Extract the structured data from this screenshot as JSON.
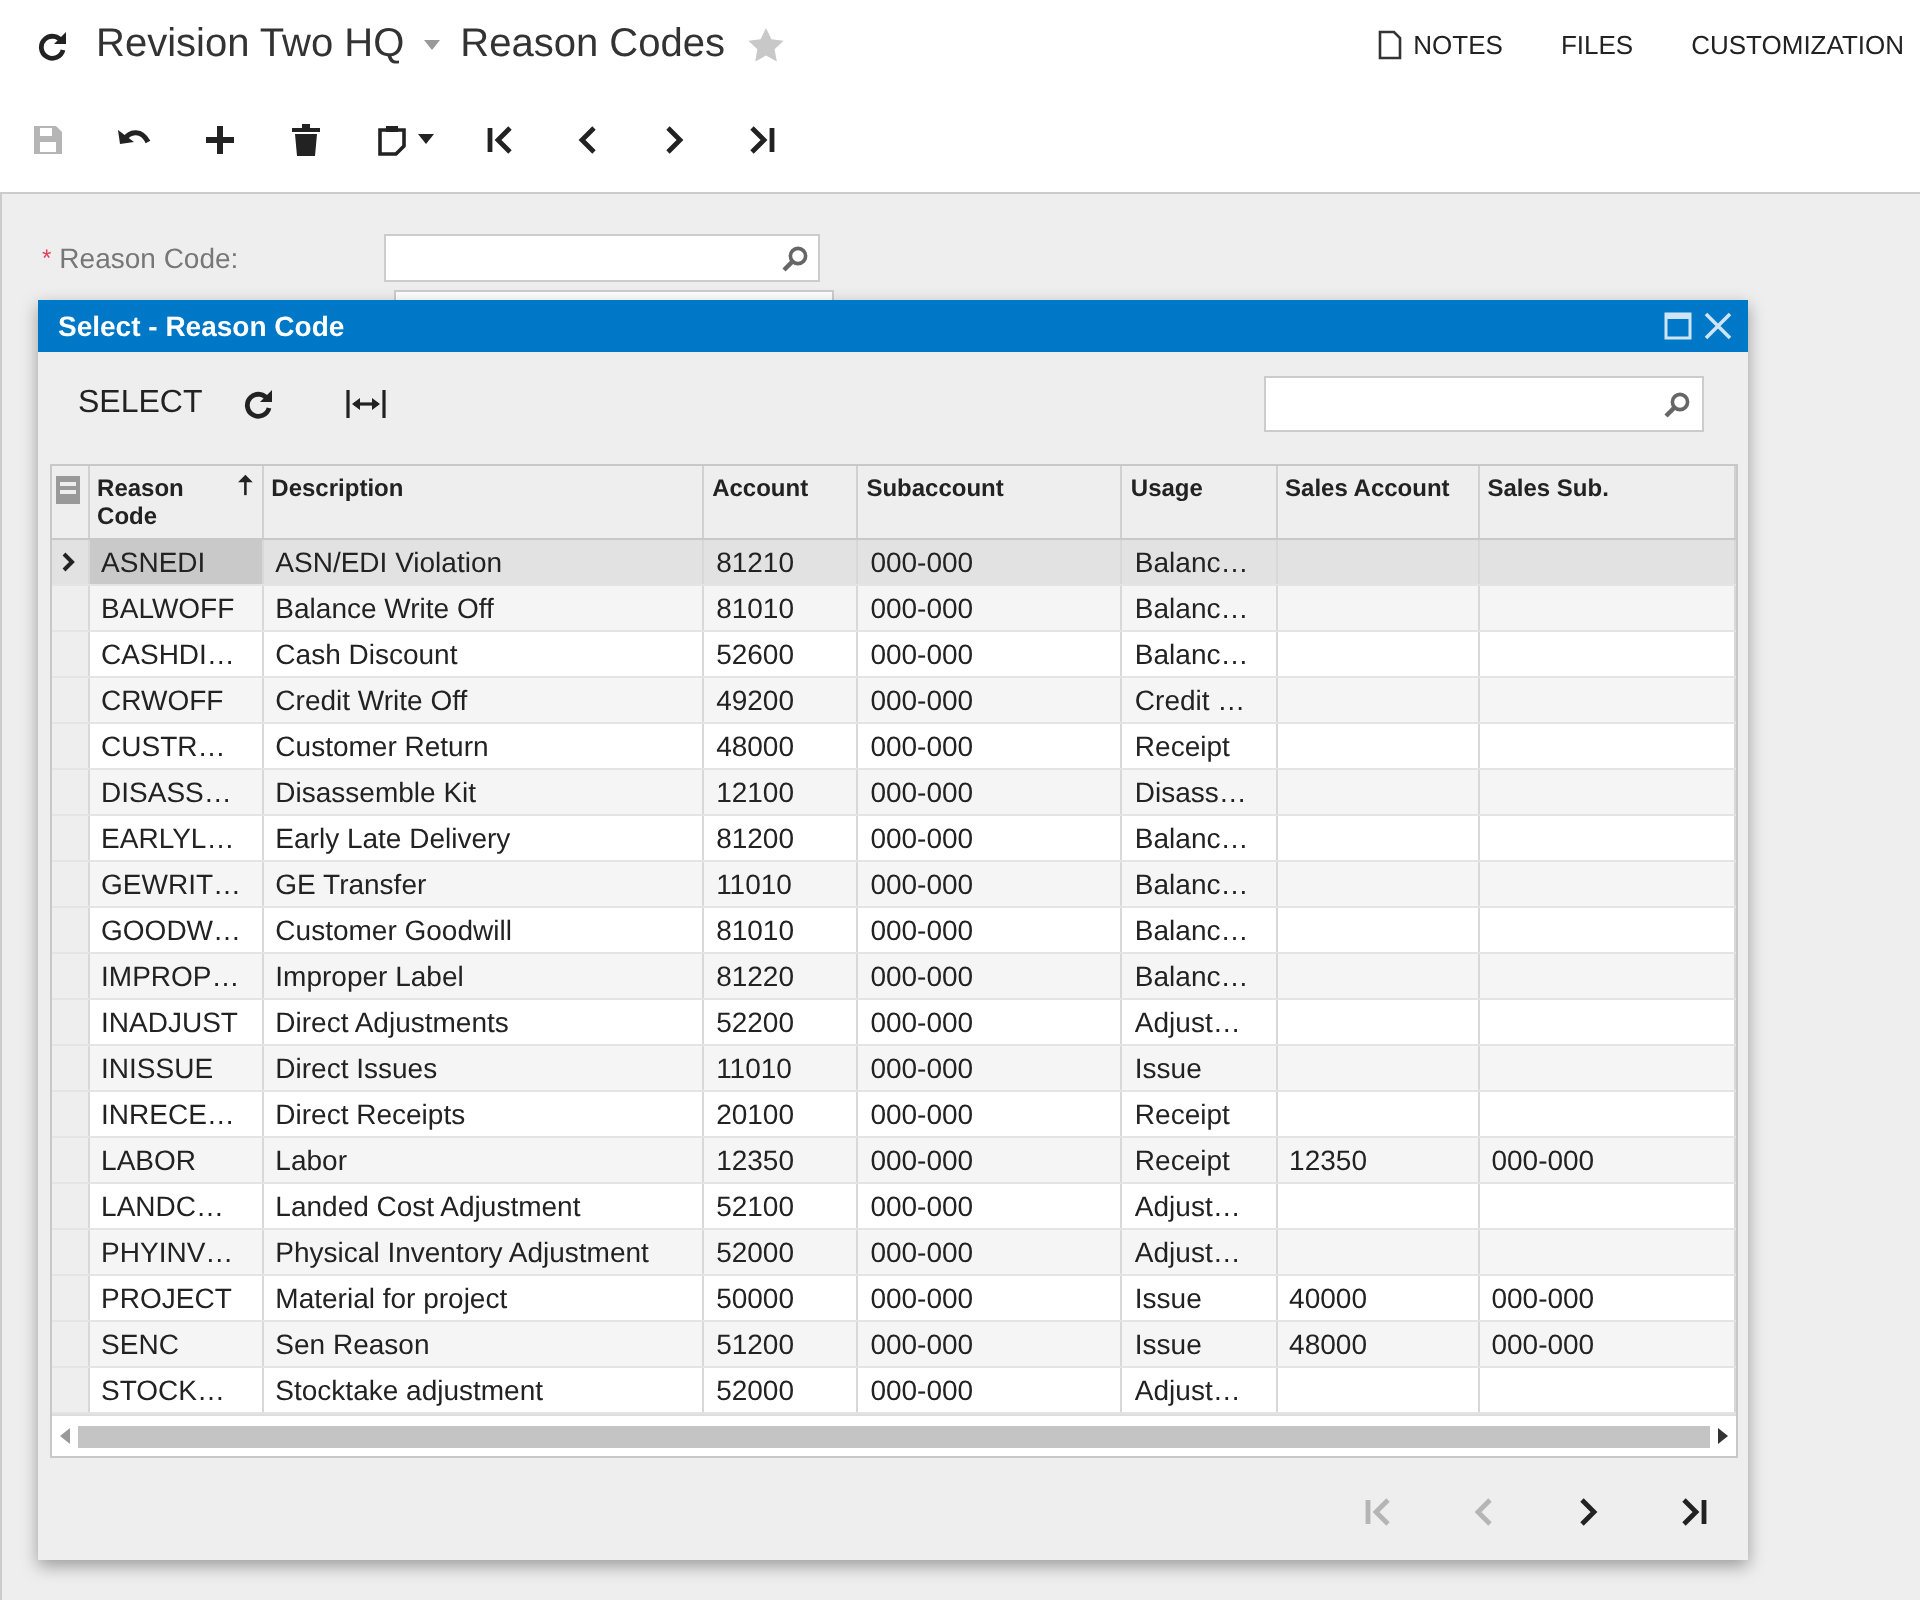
{
  "header": {
    "company": "Revision Two HQ",
    "title": "Reason Codes",
    "favorite": false,
    "links": [
      "NOTES",
      "FILES",
      "CUSTOMIZATION"
    ]
  },
  "toolbar": [
    {
      "kind": "save",
      "disabled": true
    },
    {
      "kind": "undo",
      "disabled": false
    },
    {
      "kind": "add",
      "disabled": false
    },
    {
      "kind": "delete",
      "disabled": false
    },
    {
      "kind": "clipboard",
      "disabled": false
    },
    {
      "kind": "first",
      "disabled": false
    },
    {
      "kind": "prev",
      "disabled": false
    },
    {
      "kind": "next",
      "disabled": false
    },
    {
      "kind": "last",
      "disabled": false
    }
  ],
  "form": {
    "label": "Reason Code:",
    "required_mark": "*"
  },
  "dialog": {
    "title": "Select - Reason Code",
    "select_button": "SELECT",
    "columns": [
      {
        "label": "Reason Code",
        "sorted": true
      },
      {
        "label": "Description",
        "sorted": false
      },
      {
        "label": "Account",
        "sorted": false
      },
      {
        "label": "Subaccount",
        "sorted": false
      },
      {
        "label": "Usage",
        "sorted": false
      },
      {
        "label": "Sales Account",
        "sorted": false
      },
      {
        "label": "Sales Sub.",
        "sorted": false
      }
    ],
    "rows": [
      {
        "selected": true,
        "cells": [
          "ASNEDI",
          "ASN/EDI Violation",
          "81210",
          "000-000",
          "Balanc…",
          "",
          ""
        ]
      },
      {
        "selected": false,
        "cells": [
          "BALWOFF",
          "Balance Write Off",
          "81010",
          "000-000",
          "Balanc…",
          "",
          ""
        ]
      },
      {
        "selected": false,
        "cells": [
          "CASHDI…",
          "Cash Discount",
          "52600",
          "000-000",
          "Balanc…",
          "",
          ""
        ]
      },
      {
        "selected": false,
        "cells": [
          "CRWOFF",
          "Credit Write Off",
          "49200",
          "000-000",
          "Credit …",
          "",
          ""
        ]
      },
      {
        "selected": false,
        "cells": [
          "CUSTR…",
          "Customer Return",
          "48000",
          "000-000",
          "Receipt",
          "",
          ""
        ]
      },
      {
        "selected": false,
        "cells": [
          "DISASS…",
          "Disassemble Kit",
          "12100",
          "000-000",
          "Disass…",
          "",
          ""
        ]
      },
      {
        "selected": false,
        "cells": [
          "EARLYL…",
          "Early Late Delivery",
          "81200",
          "000-000",
          "Balanc…",
          "",
          ""
        ]
      },
      {
        "selected": false,
        "cells": [
          "GEWRIT…",
          "GE Transfer",
          "11010",
          "000-000",
          "Balanc…",
          "",
          ""
        ]
      },
      {
        "selected": false,
        "cells": [
          "GOODW…",
          "Customer Goodwill",
          "81010",
          "000-000",
          "Balanc…",
          "",
          ""
        ]
      },
      {
        "selected": false,
        "cells": [
          "IMPROP…",
          "Improper Label",
          "81220",
          "000-000",
          "Balanc…",
          "",
          ""
        ]
      },
      {
        "selected": false,
        "cells": [
          "INADJUST",
          "Direct Adjustments",
          "52200",
          "000-000",
          "Adjust…",
          "",
          ""
        ]
      },
      {
        "selected": false,
        "cells": [
          "INISSUE",
          "Direct Issues",
          "11010",
          "000-000",
          "Issue",
          "",
          ""
        ]
      },
      {
        "selected": false,
        "cells": [
          "INRECE…",
          "Direct Receipts",
          "20100",
          "000-000",
          "Receipt",
          "",
          ""
        ]
      },
      {
        "selected": false,
        "cells": [
          "LABOR",
          "Labor",
          "12350",
          "000-000",
          "Receipt",
          "12350",
          "000-000"
        ]
      },
      {
        "selected": false,
        "cells": [
          "LANDC…",
          "Landed Cost Adjustment",
          "52100",
          "000-000",
          "Adjust…",
          "",
          ""
        ]
      },
      {
        "selected": false,
        "cells": [
          "PHYINV…",
          "Physical Inventory Adjustment",
          "52000",
          "000-000",
          "Adjust…",
          "",
          ""
        ]
      },
      {
        "selected": false,
        "cells": [
          "PROJECT",
          "Material for project",
          "50000",
          "000-000",
          "Issue",
          "40000",
          "000-000"
        ]
      },
      {
        "selected": false,
        "cells": [
          "SENC",
          "Sen Reason",
          "51200",
          "000-000",
          "Issue",
          "48000",
          "000-000"
        ]
      },
      {
        "selected": false,
        "cells": [
          "STOCK…",
          "Stocktake adjustment",
          "52000",
          "000-000",
          "Adjust…",
          "",
          ""
        ]
      }
    ],
    "pager": [
      {
        "kind": "first",
        "disabled": true
      },
      {
        "kind": "prev",
        "disabled": true
      },
      {
        "kind": "next",
        "disabled": false
      },
      {
        "kind": "last",
        "disabled": false
      }
    ]
  }
}
